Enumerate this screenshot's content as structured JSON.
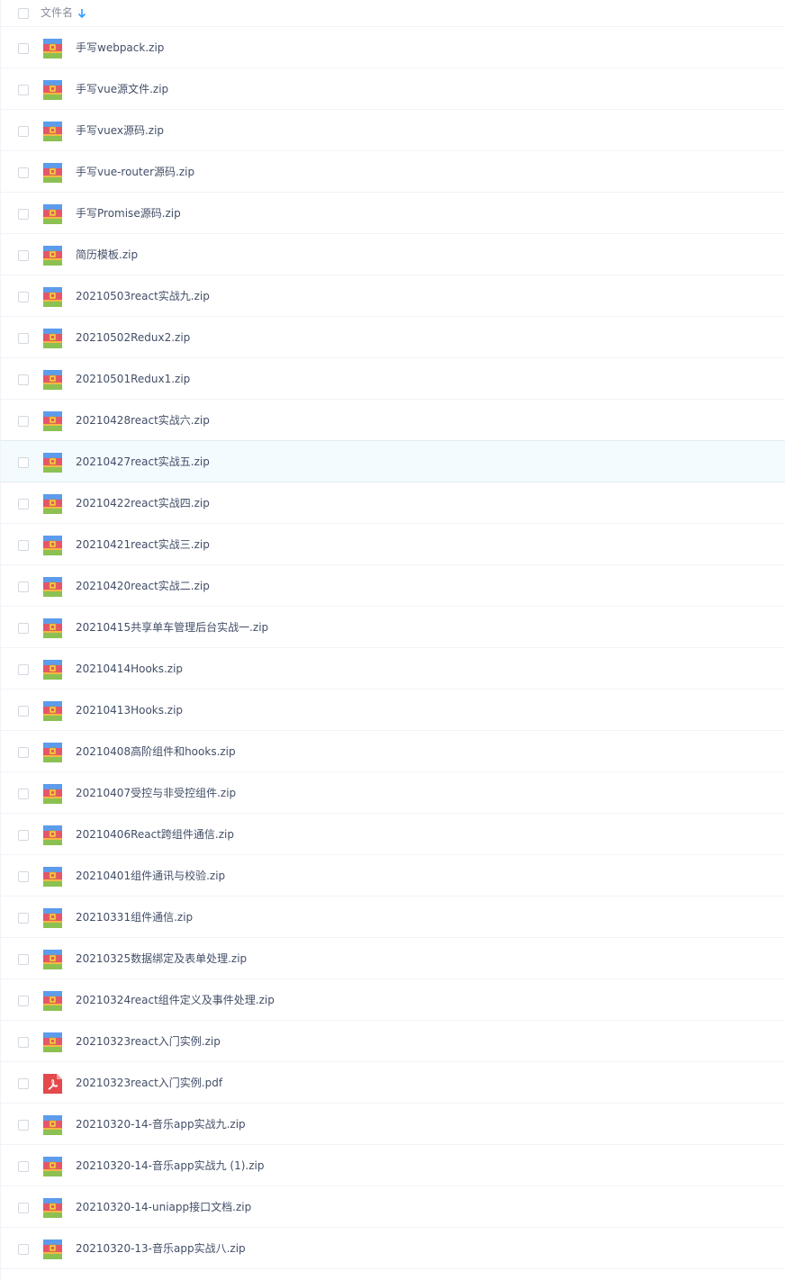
{
  "header": {
    "select_all_checked": false,
    "column_label": "文件名",
    "sort_icon": "arrow-down-icon",
    "sort_direction": "descending"
  },
  "colors": {
    "row_divider": "#f1f3f8",
    "hover_row_background": "#f4fbff",
    "sort_arrow": "#2e9fff",
    "text": "#424e67",
    "header_text": "#878c9c"
  },
  "files": [
    {
      "name": "手写webpack.zip",
      "type": "zip",
      "icon": "zip-archive-icon"
    },
    {
      "name": "手写vue源文件.zip",
      "type": "zip",
      "icon": "zip-archive-icon"
    },
    {
      "name": "手写vuex源码.zip",
      "type": "zip",
      "icon": "zip-archive-icon"
    },
    {
      "name": "手写vue-router源码.zip",
      "type": "zip",
      "icon": "zip-archive-icon"
    },
    {
      "name": "手写Promise源码.zip",
      "type": "zip",
      "icon": "zip-archive-icon"
    },
    {
      "name": "简历模板.zip",
      "type": "zip",
      "icon": "zip-archive-icon"
    },
    {
      "name": "20210503react实战九.zip",
      "type": "zip",
      "icon": "zip-archive-icon"
    },
    {
      "name": "20210502Redux2.zip",
      "type": "zip",
      "icon": "zip-archive-icon"
    },
    {
      "name": "20210501Redux1.zip",
      "type": "zip",
      "icon": "zip-archive-icon"
    },
    {
      "name": "20210428react实战六.zip",
      "type": "zip",
      "icon": "zip-archive-icon"
    },
    {
      "name": "20210427react实战五.zip",
      "type": "zip",
      "icon": "zip-archive-icon",
      "hovered": true
    },
    {
      "name": "20210422react实战四.zip",
      "type": "zip",
      "icon": "zip-archive-icon"
    },
    {
      "name": "20210421react实战三.zip",
      "type": "zip",
      "icon": "zip-archive-icon"
    },
    {
      "name": "20210420react实战二.zip",
      "type": "zip",
      "icon": "zip-archive-icon"
    },
    {
      "name": "20210415共享单车管理后台实战一.zip",
      "type": "zip",
      "icon": "zip-archive-icon"
    },
    {
      "name": "20210414Hooks.zip",
      "type": "zip",
      "icon": "zip-archive-icon"
    },
    {
      "name": "20210413Hooks.zip",
      "type": "zip",
      "icon": "zip-archive-icon"
    },
    {
      "name": "20210408高阶组件和hooks.zip",
      "type": "zip",
      "icon": "zip-archive-icon"
    },
    {
      "name": "20210407受控与非受控组件.zip",
      "type": "zip",
      "icon": "zip-archive-icon"
    },
    {
      "name": "20210406React跨组件通信.zip",
      "type": "zip",
      "icon": "zip-archive-icon"
    },
    {
      "name": "20210401组件通讯与校验.zip",
      "type": "zip",
      "icon": "zip-archive-icon"
    },
    {
      "name": "20210331组件通信.zip",
      "type": "zip",
      "icon": "zip-archive-icon"
    },
    {
      "name": "20210325数据绑定及表单处理.zip",
      "type": "zip",
      "icon": "zip-archive-icon"
    },
    {
      "name": "20210324react组件定义及事件处理.zip",
      "type": "zip",
      "icon": "zip-archive-icon"
    },
    {
      "name": "20210323react入门实例.zip",
      "type": "zip",
      "icon": "zip-archive-icon"
    },
    {
      "name": "20210323react入门实例.pdf",
      "type": "pdf",
      "icon": "pdf-file-icon"
    },
    {
      "name": "20210320-14-音乐app实战九.zip",
      "type": "zip",
      "icon": "zip-archive-icon"
    },
    {
      "name": "20210320-14-音乐app实战九 (1).zip",
      "type": "zip",
      "icon": "zip-archive-icon"
    },
    {
      "name": "20210320-14-uniapp接口文档.zip",
      "type": "zip",
      "icon": "zip-archive-icon"
    },
    {
      "name": "20210320-13-音乐app实战八.zip",
      "type": "zip",
      "icon": "zip-archive-icon"
    }
  ]
}
